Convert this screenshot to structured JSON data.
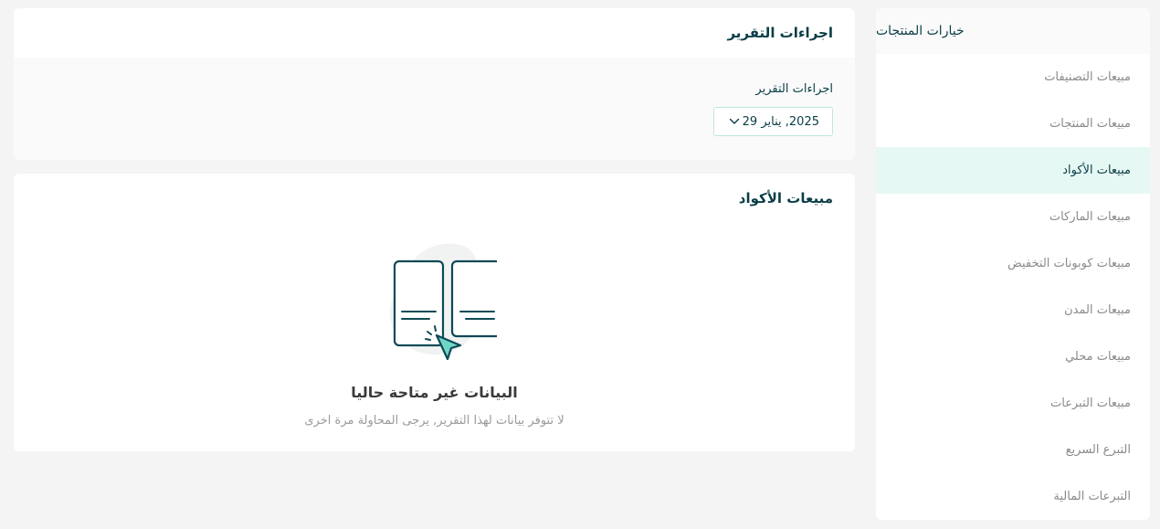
{
  "sidebar": {
    "header": "خيارات المنتجات",
    "items": [
      {
        "label": "مبيعات التصنيفات",
        "active": false
      },
      {
        "label": "مبيعات المنتجات",
        "active": false
      },
      {
        "label": "مبيعات الأكواد",
        "active": true
      },
      {
        "label": "مبيعات الماركات",
        "active": false
      },
      {
        "label": "مبيعات كوبونات التخفيض",
        "active": false
      },
      {
        "label": "مبيعات المدن",
        "active": false
      },
      {
        "label": "مبيعات محلي",
        "active": false
      },
      {
        "label": "مبيعات التبرعات",
        "active": false
      },
      {
        "label": "التبرع السريع",
        "active": false
      },
      {
        "label": "التبرعات المالية",
        "active": false
      }
    ]
  },
  "report_actions": {
    "title": "اجراءات التقرير",
    "field_label": "اجراءات التقرير",
    "date_value": "2025, يناير 29"
  },
  "sales": {
    "title": "مبيعات الأكواد",
    "empty_title": "البيانات غير متاحة حاليا",
    "empty_subtitle": "لا تتوفر بيانات لهذا التقرير, يرجى المحاولة مرة اخرى"
  },
  "colors": {
    "accent_active_bg": "#e6f8f4",
    "primary_text": "#0a3d46",
    "illustration_stroke": "#0e4a55",
    "illustration_accent": "#6fd6c6"
  },
  "icons": {
    "date_dropdown": "chevron-down-icon",
    "empty_state": "empty-report-illustration"
  }
}
